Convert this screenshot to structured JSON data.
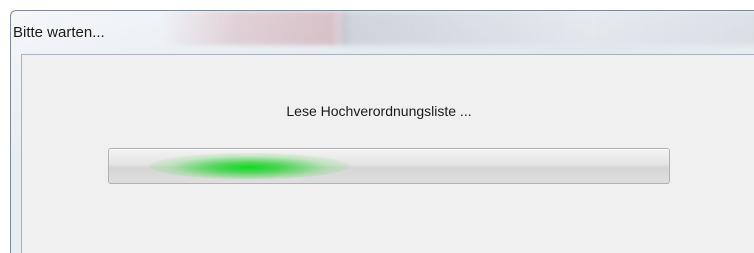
{
  "window": {
    "title": "Bitte warten..."
  },
  "dialog": {
    "message": "Lese Hochverordnungsliste ..."
  },
  "progress": {
    "mode": "indeterminate",
    "accent_color": "#1fd628"
  }
}
